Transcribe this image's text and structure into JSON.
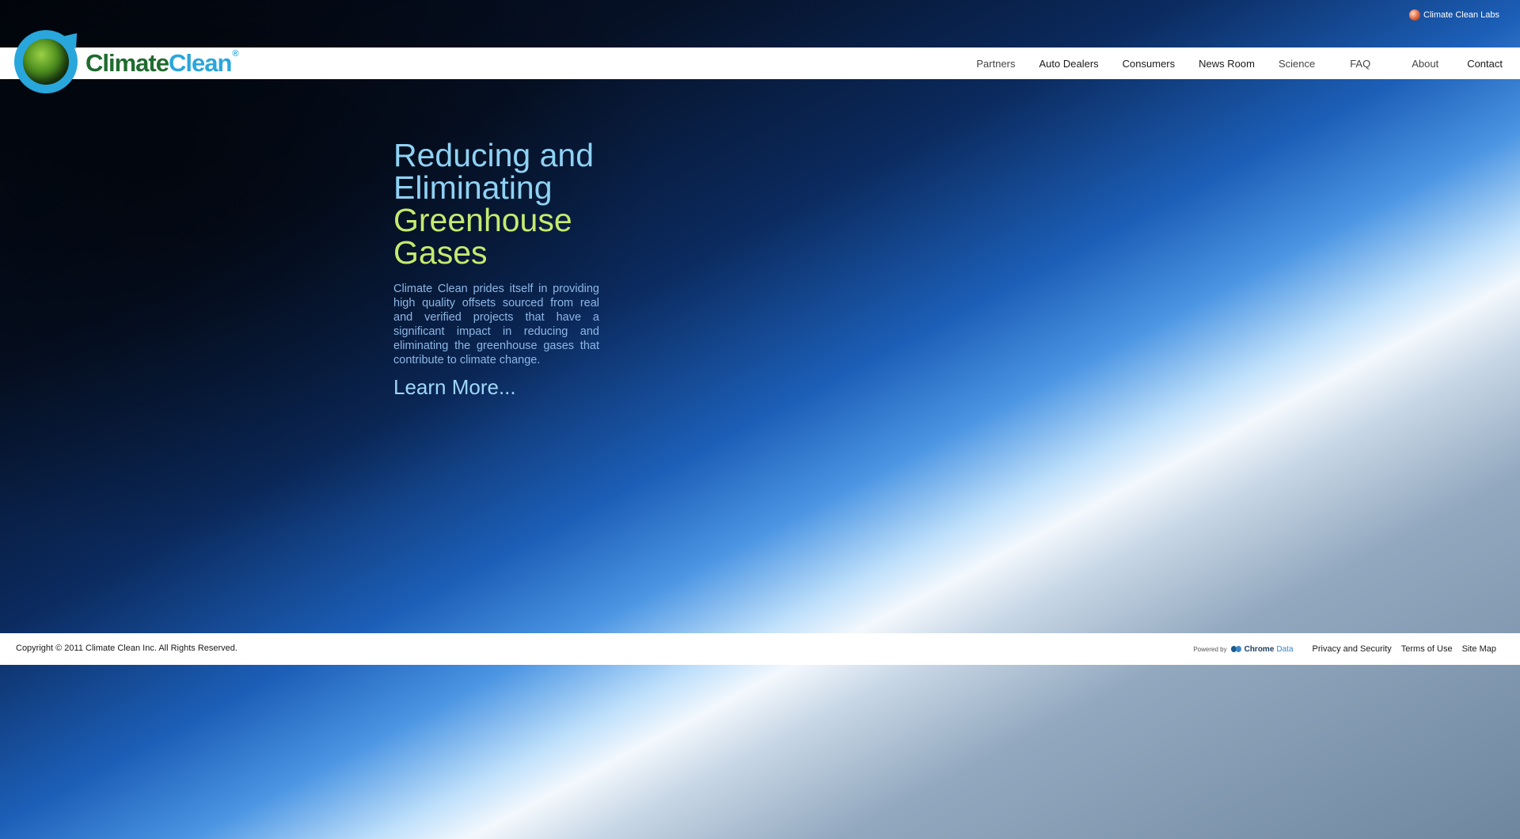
{
  "top_link": {
    "label": "Climate Clean Labs",
    "icon": "labs-globe-icon"
  },
  "logo": {
    "word1": "Climate",
    "word2": "Clean",
    "reg": "®"
  },
  "nav": {
    "items": [
      "Partners",
      "Auto Dealers",
      "Consumers",
      "News Room",
      "Science",
      "FAQ",
      "About",
      "Contact"
    ]
  },
  "hero": {
    "title_line1": "Reducing and",
    "title_line2": "Eliminating",
    "title_line3": "Greenhouse",
    "title_line4": "Gases",
    "body": "Climate Clean prides itself in providing high quality offsets sourced from real and verified projects that have a significant impact in reducing and eliminating the greenhouse gases that contribute to climate change.",
    "link": "Learn More..."
  },
  "footer": {
    "copyright": "Copyright © 2011 Climate Clean Inc. All Rights Reserved.",
    "powered_by": "Powered by",
    "chrome_word1": "Chrome",
    "chrome_word2": "Data",
    "links": [
      "Privacy and Security",
      "Terms of Use",
      "Site Map"
    ]
  },
  "colors": {
    "title_blue": "#8fd2f3",
    "title_green": "#c6ea6f",
    "logo_green": "#1f6b2e",
    "logo_blue": "#29a6dc"
  }
}
